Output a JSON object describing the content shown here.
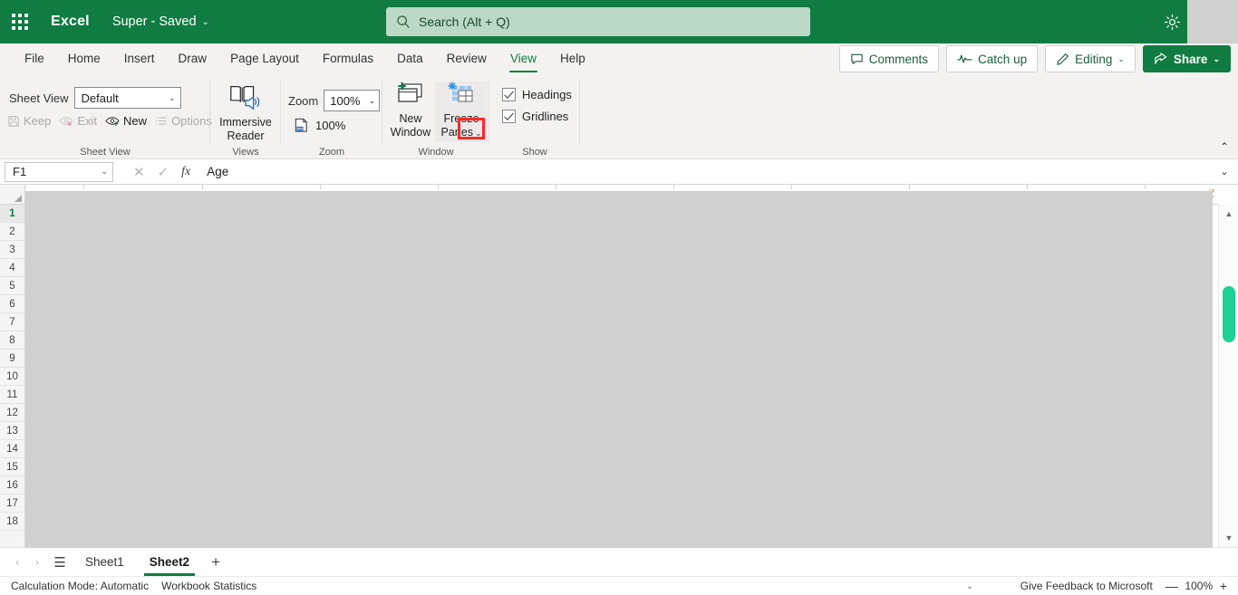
{
  "titlebar": {
    "app_name": "Excel",
    "doc_title": "Super  -  Saved",
    "doc_chevron": "⌄",
    "waffle_name": "app-launcher",
    "gear_name": "settings-gear"
  },
  "search": {
    "placeholder": "Search (Alt + Q)"
  },
  "ribbon_tabs": [
    {
      "label": "File",
      "active": false
    },
    {
      "label": "Home",
      "active": false
    },
    {
      "label": "Insert",
      "active": false
    },
    {
      "label": "Draw",
      "active": false
    },
    {
      "label": "Page Layout",
      "active": false
    },
    {
      "label": "Formulas",
      "active": false
    },
    {
      "label": "Data",
      "active": false
    },
    {
      "label": "Review",
      "active": false
    },
    {
      "label": "View",
      "active": true
    },
    {
      "label": "Help",
      "active": false
    }
  ],
  "tab_actions": {
    "comments": "Comments",
    "catch_up": "Catch up",
    "editing": "Editing",
    "share": "Share",
    "chevron": "⌄"
  },
  "ribbon": {
    "sheet_view": {
      "group_label": "Sheet View",
      "field_label": "Sheet View",
      "select_value": "Default",
      "select_chevron": "⌄",
      "keep": "Keep",
      "exit": "Exit",
      "new": "New",
      "options": "Options"
    },
    "views": {
      "group_label": "Views",
      "immersive_reader_line1": "Immersive",
      "immersive_reader_line2": "Reader"
    },
    "zoom": {
      "group_label": "Zoom",
      "field_label": "Zoom",
      "select_value": "100%",
      "select_chevron": "⌄",
      "zoom_100": "100%"
    },
    "window": {
      "group_label": "Window",
      "new_window_line1": "New",
      "new_window_line2": "Window",
      "freeze_line1": "Freeze",
      "freeze_line2": "Panes",
      "freeze_chevron": "⌄"
    },
    "show": {
      "group_label": "Show",
      "headings": "Headings",
      "headings_checked": true,
      "gridlines": "Gridlines",
      "gridlines_checked": true,
      "check_glyph": "✓"
    },
    "collapse_chevron": "⌃"
  },
  "formula_bar": {
    "name_box_value": "F1",
    "name_box_chevron": "⌄",
    "cancel_glyph": "✕",
    "enter_glyph": "✓",
    "fx_glyph": "fx",
    "content": "Age",
    "expand_chevron": "⌄"
  },
  "grid": {
    "rows": [
      "1",
      "2",
      "3",
      "4",
      "5",
      "6",
      "7",
      "8",
      "9",
      "10",
      "11",
      "12",
      "13",
      "14",
      "15",
      "16",
      "17",
      "18"
    ],
    "selected_row": "1",
    "last_visible_column": "Z",
    "scroll_up_glyph": "▲",
    "scroll_down_glyph": "▼"
  },
  "sheet_tabs": {
    "prev_glyph": "‹",
    "next_glyph": "›",
    "all_sheets_glyph": "☰",
    "add_glyph": "+",
    "tabs": [
      {
        "label": "Sheet1",
        "active": false
      },
      {
        "label": "Sheet2",
        "active": true
      }
    ]
  },
  "status_bar": {
    "calculation_mode": "Calculation Mode: Automatic",
    "workbook_statistics": "Workbook Statistics",
    "expand_chevron": "⌄",
    "feedback": "Give Feedback to Microsoft",
    "zoom_minus": "—",
    "zoom_value": "100%",
    "zoom_plus": "+"
  },
  "colors": {
    "brand_green": "#107c41",
    "search_bg": "#bcd8c6",
    "ribbon_bg": "#f3f2f1",
    "dim_overlay": "#d0d0d0",
    "highlight_red": "#f42b2b",
    "scroll_thumb": "#1ed095"
  }
}
